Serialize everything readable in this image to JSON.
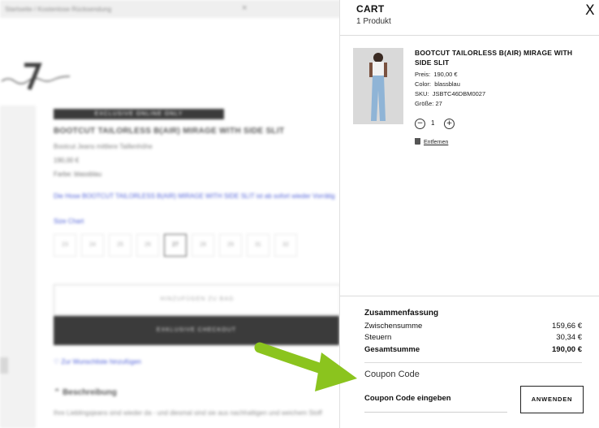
{
  "background_page": {
    "topbar_text": "Startseite / Kostenlose Rücksendung",
    "badge": "EXCLUSIVE ONLINE ONLY",
    "product_title": "BOOTCUT TAILORLESS B(AIR) MIRAGE WITH SIDE SLIT",
    "subtitle": "Bootcut Jeans mittlere Taillenhöhe",
    "price": "190,00 €",
    "color": "Farbe: blassblau",
    "promo_link": "Die Hose BOOTCUT TAILORLESS B(AIR) MIRAGE WITH SIDE SLIT ist ab sofort wieder Vorrätig",
    "size_chart": "Size Chart",
    "sizes": [
      "23",
      "24",
      "25",
      "26",
      "27",
      "28",
      "29",
      "31",
      "32"
    ],
    "selected_size": "27",
    "add_button": "HINZUFÜGEN ZU BAG",
    "checkout_button": "EXKLUSIVE CHECKOUT",
    "wishlist": "Zur Wunschliste hinzufügen",
    "description_heading": "Beschreibung",
    "description_text": "Ihre Lieblingsjeans sind wieder da - und diesmal sind sie aus nachhaltigen und weichem Stoff"
  },
  "cart": {
    "title": "CART",
    "count_label": "1 Produkt",
    "close_label": "X",
    "item": {
      "name": "BOOTCUT TAILORLESS B(AIR) MIRAGE WITH SIDE SLIT",
      "price_label": "Preis:",
      "price_value": "190,00 €",
      "color_label": "Color:",
      "color_value": "blassblau",
      "sku_label": "SKU:",
      "sku_value": "JSBTC46DBM0027",
      "size_label": "Größe:",
      "size_value": "27",
      "quantity": "1",
      "minus": "−",
      "plus": "+",
      "remove_label": "Entfernen"
    },
    "summary": {
      "heading": "Zusammenfassung",
      "subtotal_label": "Zwischensumme",
      "subtotal_value": "159,66 €",
      "tax_label": "Steuern",
      "tax_value": "30,34 €",
      "total_label": "Gesamtsumme",
      "total_value": "190,00 €"
    },
    "coupon": {
      "title": "Coupon Code",
      "input_label": "Coupon Code eingeben",
      "apply_button": "ANWENDEN"
    }
  },
  "colors": {
    "arrow": "#8bc41e",
    "link": "#2a3fd1",
    "dark": "#111111"
  }
}
